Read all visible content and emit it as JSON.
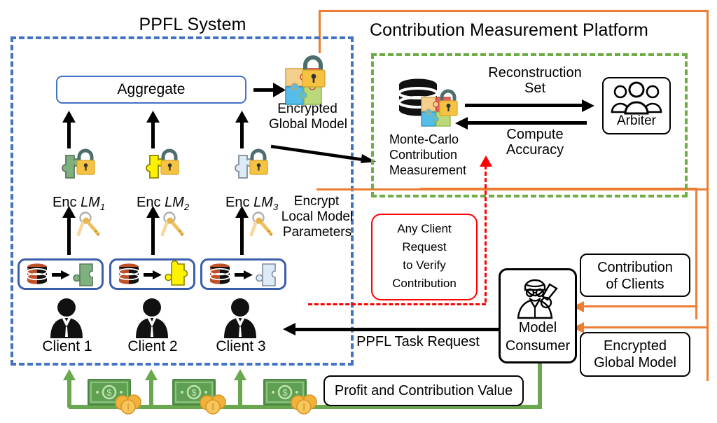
{
  "regions": {
    "ppfl_title": "PPFL System",
    "cmp_title": "Contribution Measurement Platform"
  },
  "ppfl": {
    "aggregate_label": "Aggregate",
    "encrypted_global_model_line1": "Encrypted",
    "encrypted_global_model_line2": "Global Model",
    "enc_lm": [
      {
        "prefix": "Enc ",
        "model": "LM",
        "index": "1",
        "color": "#7FB07F",
        "name": "enc-lm-1"
      },
      {
        "prefix": "Enc ",
        "model": "LM",
        "index": "2",
        "color": "#FFF200",
        "name": "enc-lm-2"
      },
      {
        "prefix": "Enc ",
        "model": "LM",
        "index": "3",
        "color": "#DCEBF7",
        "name": "enc-lm-3"
      }
    ],
    "encrypt_note_line1": "Encrypt",
    "encrypt_note_line2": "Local Model",
    "encrypt_note_line3": "Parameters",
    "clients": [
      {
        "label": "Client 1",
        "puzzle_color": "#7FB07F"
      },
      {
        "label": "Client 2",
        "puzzle_color": "#FFF200"
      },
      {
        "label": "Client 3",
        "puzzle_color": "#DCEBF7"
      }
    ]
  },
  "platform": {
    "mcm_line1": "Monte-Carlo",
    "mcm_line2": "Contribution",
    "mcm_line3": "Measurement",
    "reconstruction_set_line1": "Reconstruction",
    "reconstruction_set_line2": "Set",
    "compute_accuracy_line1": "Compute",
    "compute_accuracy_line2": "Accuracy",
    "arbiter_label": "Arbiter"
  },
  "messages": {
    "any_client_request": [
      "Any Client",
      "Request",
      "to Verify",
      "Contribution"
    ],
    "ppfl_task_request": "PPFL Task Request",
    "model_consumer_line1": "Model",
    "model_consumer_line2": "Consumer",
    "contribution_of_clients_line1": "Contribution",
    "contribution_of_clients_line2": "of Clients",
    "encrypted_global_model_line1": "Encrypted",
    "encrypted_global_model_line2": "Global Model",
    "profit_and_contribution_value": "Profit and Contribution Value"
  },
  "colors": {
    "blue_dashed": "#4472C4",
    "green_dashed": "#70AD47",
    "orange": "#ED7D31",
    "red": "#FF0000",
    "money_green": "#6AA84F",
    "lock_yellow": "#F5C242",
    "lock_shackle": "#4E6E6E",
    "key_gold": "#F0C060",
    "db_orange": "#C0522A"
  },
  "icons": {
    "lock": "lock-icon",
    "puzzle": "puzzle-piece-icon",
    "puzzle_group": "puzzle-group-icon",
    "database": "database-icon",
    "key": "key-icon",
    "person": "person-icon",
    "people": "people-group-icon",
    "scientist": "scientist-icon",
    "banknote": "banknote-icon",
    "coins": "coins-icon",
    "arrow": "arrow-icon"
  }
}
